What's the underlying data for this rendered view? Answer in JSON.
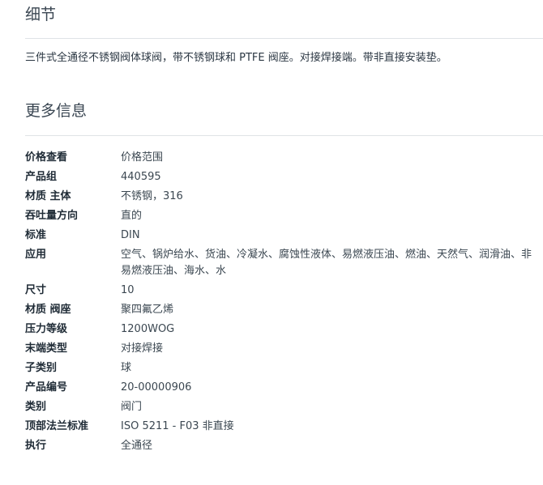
{
  "details": {
    "title": "细节",
    "description": "三件式全通径不锈钢阀体球阀，带不锈钢球和 PTFE 阀座。对接焊接端。带非直接安装垫。"
  },
  "more_info": {
    "title": "更多信息",
    "rows": [
      {
        "label": "价格查看",
        "value": "价格范围"
      },
      {
        "label": "产品组",
        "value": "440595"
      },
      {
        "label": "材质 主体",
        "value": "不锈钢，316"
      },
      {
        "label": "吞吐量方向",
        "value": "直的"
      },
      {
        "label": "标准",
        "value": "DIN"
      },
      {
        "label": "应用",
        "value": "空气、锅炉给水、货油、冷凝水、腐蚀性液体、易燃液压油、燃油、天然气、润滑油、非易燃液压油、海水、水"
      },
      {
        "label": "尺寸",
        "value": "10"
      },
      {
        "label": "材质 阀座",
        "value": "聚四氟乙烯"
      },
      {
        "label": "压力等级",
        "value": "1200WOG"
      },
      {
        "label": "末端类型",
        "value": "对接焊接"
      },
      {
        "label": "子类别",
        "value": "球"
      },
      {
        "label": "产品编号",
        "value": "20-00000906"
      },
      {
        "label": "类别",
        "value": "阀门"
      },
      {
        "label": "顶部法兰标准",
        "value": "ISO 5211 - F03 非直接"
      },
      {
        "label": "执行",
        "value": "全通径"
      }
    ]
  }
}
